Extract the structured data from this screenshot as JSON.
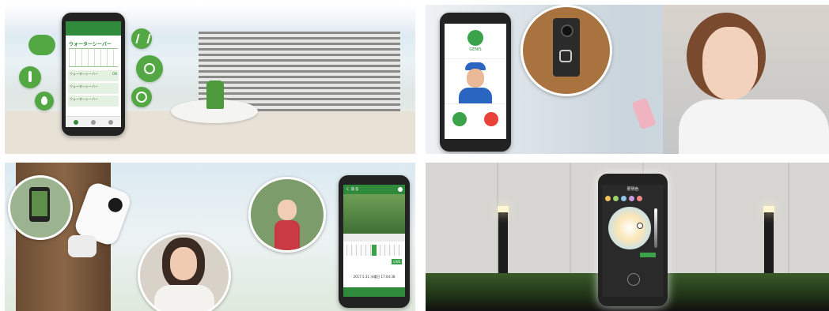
{
  "panel1": {
    "app_title": "ウォーターシーバー",
    "rows": [
      "ウォーターシーバー",
      "ウォーターシーバー",
      "ウォーターシーバー"
    ],
    "row_badge": "ON"
  },
  "panel2": {
    "brand": "GENIS"
  },
  "panel3": {
    "header": "く 戻る",
    "datetime": "2017.5.31 水曜日 17:04:38",
    "live_label": "LIVE"
  },
  "panel4": {
    "header": "照明色"
  },
  "colors": {
    "brand_green": "#2f8a3c",
    "accent_green": "#53a844",
    "decline_red": "#e8413a",
    "accept_green": "#3aa34a"
  }
}
